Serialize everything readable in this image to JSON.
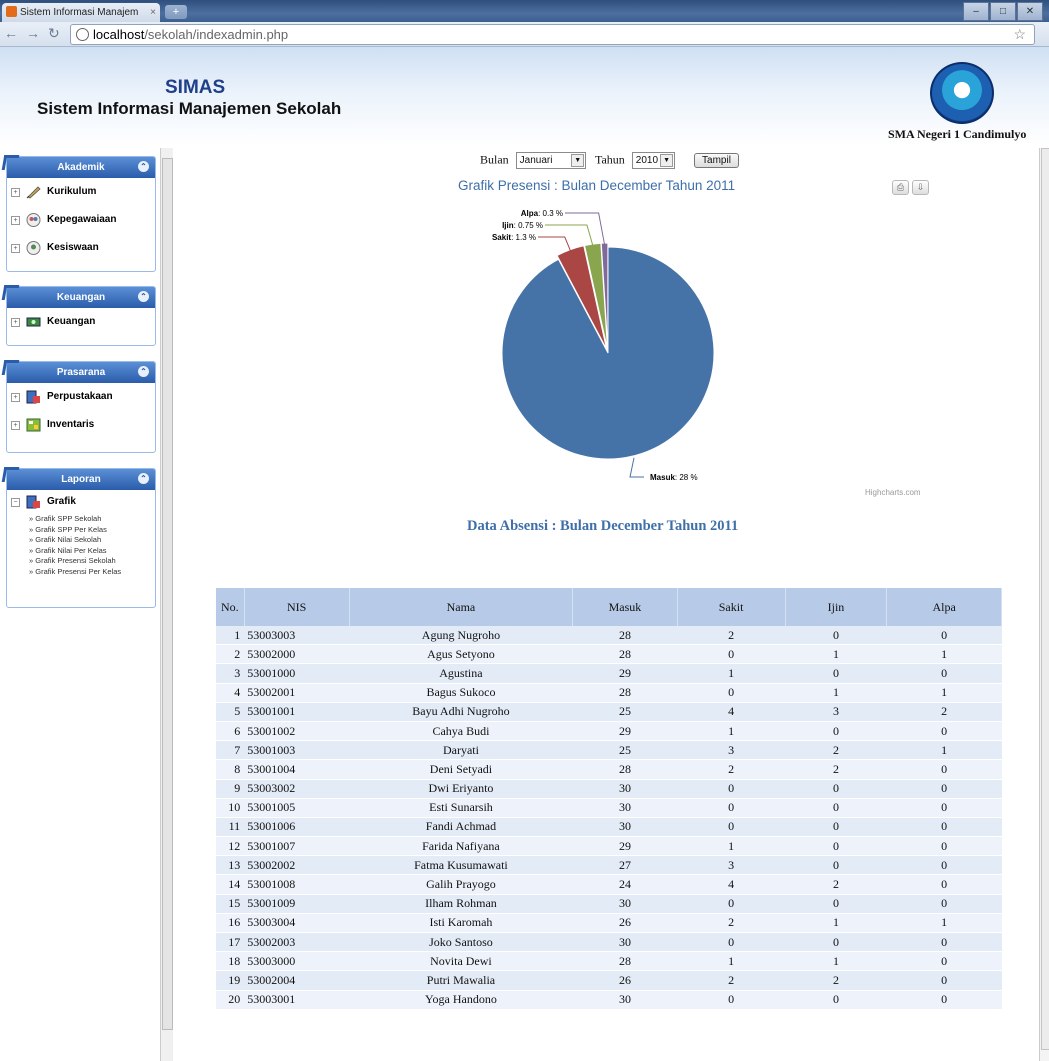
{
  "browser": {
    "tab_title": "Sistem Informasi Manajem",
    "tab_close": "×",
    "new_tab": "+",
    "url_host": "localhost",
    "url_path": "/sekolah/indexadmin.php",
    "window_buttons": [
      "–",
      "□",
      "✕"
    ]
  },
  "header": {
    "brand_short": "SIMAS",
    "brand_long": "Sistem Informasi Manajemen Sekolah",
    "school": "SMA Negeri 1 Candimulyo"
  },
  "sidebar": {
    "panels": [
      {
        "title": "Akademik",
        "items": [
          "Kurikulum",
          "Kepegawaiaan",
          "Kesiswaan"
        ]
      },
      {
        "title": "Keuangan",
        "items": [
          "Keuangan"
        ]
      },
      {
        "title": "Prasarana",
        "items": [
          "Perpustakaan",
          "Inventaris"
        ]
      },
      {
        "title": "Laporan",
        "items": [
          "Grafik"
        ],
        "sublinks": [
          "» Grafik SPP Sekolah",
          "» Grafik SPP Per Kelas",
          "» Grafik Nilai Sekolah",
          "» Grafik Nilai Per Kelas",
          "» Grafik Presensi Sekolah",
          "» Grafik Presensi Per Kelas"
        ]
      }
    ]
  },
  "filters": {
    "bulan_label": "Bulan",
    "bulan_value": "Januari",
    "tahun_label": "Tahun",
    "tahun_value": "2010",
    "button": "Tampil"
  },
  "chart_title": "Grafik Presensi : Bulan December Tahun 2011",
  "credits": "Highcharts.com",
  "colors": {
    "masuk": "#4572a7",
    "sakit": "#aa4643",
    "ijin": "#89a54e",
    "alpa": "#80699b",
    "accent": "#3e6fa8"
  },
  "chart_data": {
    "type": "pie",
    "title": "Grafik Presensi : Bulan December Tahun 2011",
    "series": [
      {
        "name": "Masuk",
        "value": 28,
        "label": "Masuk",
        "suffix": ": 28 %"
      },
      {
        "name": "Sakit",
        "value": 1.3,
        "label": "Sakit",
        "suffix": ": 1.3 %"
      },
      {
        "name": "Ijin",
        "value": 0.75,
        "label": "Ijin",
        "suffix": ": 0.75 %"
      },
      {
        "name": "Alpa",
        "value": 0.3,
        "label": "Alpa",
        "suffix": ": 0.3 %"
      }
    ]
  },
  "section_title": "Data Absensi : Bulan December Tahun 2011",
  "table": {
    "headers": [
      "No.",
      "NIS",
      "Nama",
      "Masuk",
      "Sakit",
      "Ijin",
      "Alpa"
    ],
    "rows": [
      [
        "1",
        "53003003",
        "Agung Nugroho",
        "28",
        "2",
        "0",
        "0"
      ],
      [
        "2",
        "53002000",
        "Agus Setyono",
        "28",
        "0",
        "1",
        "1"
      ],
      [
        "3",
        "53001000",
        "Agustina",
        "29",
        "1",
        "0",
        "0"
      ],
      [
        "4",
        "53002001",
        "Bagus Sukoco",
        "28",
        "0",
        "1",
        "1"
      ],
      [
        "5",
        "53001001",
        "Bayu Adhi Nugroho",
        "25",
        "4",
        "3",
        "2"
      ],
      [
        "6",
        "53001002",
        "Cahya Budi",
        "29",
        "1",
        "0",
        "0"
      ],
      [
        "7",
        "53001003",
        "Daryati",
        "25",
        "3",
        "2",
        "1"
      ],
      [
        "8",
        "53001004",
        "Deni Setyadi",
        "28",
        "2",
        "2",
        "0"
      ],
      [
        "9",
        "53003002",
        "Dwi Eriyanto",
        "30",
        "0",
        "0",
        "0"
      ],
      [
        "10",
        "53001005",
        "Esti Sunarsih",
        "30",
        "0",
        "0",
        "0"
      ],
      [
        "11",
        "53001006",
        "Fandi Achmad",
        "30",
        "0",
        "0",
        "0"
      ],
      [
        "12",
        "53001007",
        "Farida Nafiyana",
        "29",
        "1",
        "0",
        "0"
      ],
      [
        "13",
        "53002002",
        "Fatma Kusumawati",
        "27",
        "3",
        "0",
        "0"
      ],
      [
        "14",
        "53001008",
        "Galih Prayogo",
        "24",
        "4",
        "2",
        "0"
      ],
      [
        "15",
        "53001009",
        "Ilham Rohman",
        "30",
        "0",
        "0",
        "0"
      ],
      [
        "16",
        "53003004",
        "Isti Karomah",
        "26",
        "2",
        "1",
        "1"
      ],
      [
        "17",
        "53002003",
        "Joko Santoso",
        "30",
        "0",
        "0",
        "0"
      ],
      [
        "18",
        "53003000",
        "Novita Dewi",
        "28",
        "1",
        "1",
        "0"
      ],
      [
        "19",
        "53002004",
        "Putri Mawalia",
        "26",
        "2",
        "2",
        "0"
      ],
      [
        "20",
        "53003001",
        "Yoga Handono",
        "30",
        "0",
        "0",
        "0"
      ]
    ]
  }
}
